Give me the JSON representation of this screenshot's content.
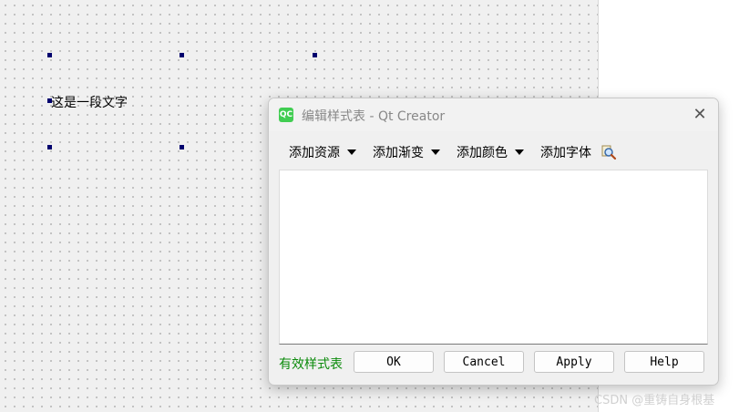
{
  "canvas": {
    "label_text": "这是一段文字"
  },
  "dialog": {
    "icon_text": "QC",
    "title": "编辑样式表 - Qt Creator",
    "close_glyph": "✕",
    "toolbar": {
      "add_resource": "添加资源",
      "add_gradient": "添加渐变",
      "add_color": "添加颜色",
      "add_font": "添加字体"
    },
    "editor_value": "",
    "status_text": "有效样式表",
    "status_color": "#0a8a0a",
    "buttons": {
      "ok": "OK",
      "cancel": "Cancel",
      "apply": "Apply",
      "help": "Help"
    }
  },
  "watermark": "CSDN @重铸自身根基",
  "icons": {
    "app": "qt-creator-icon",
    "close": "close-icon",
    "dropdown": "chevron-down-icon",
    "search": "magnifier-icon"
  },
  "colors": {
    "selection_handle": "#00006e",
    "qt_green": "#41cd52"
  }
}
